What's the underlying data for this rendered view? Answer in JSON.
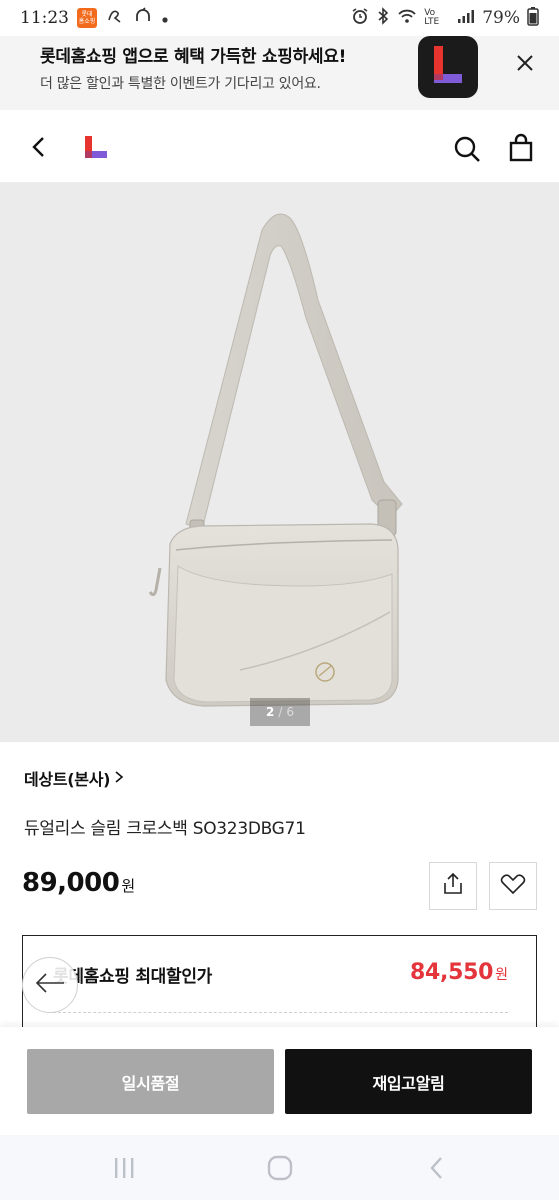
{
  "status_bar": {
    "time": "11:23",
    "app_icon_label": "롯데\n홈쇼핑",
    "network_label": "Vo LTE",
    "battery": "79%"
  },
  "app_banner": {
    "title": "롯데홈쇼핑 앱으로 혜택 가득한 쇼핑하세요!",
    "subtitle": "더 많은 할인과 특별한 이벤트가 기다리고 있어요."
  },
  "header": {
    "logo_icon": "lotte-l-logo-icon",
    "search_icon": "search-icon",
    "cart_icon": "shopping-bag-icon"
  },
  "image_gallery": {
    "current": "2",
    "separator": "/",
    "total": "6"
  },
  "product": {
    "brand": "데상트(본사)",
    "name": "듀얼리스 슬림 크로스백 SO323DBG71",
    "price": "89,000",
    "price_unit": "원"
  },
  "max_discount": {
    "label": "롯데홈쇼핑 최대할인가",
    "price": "84,550",
    "unit": "원"
  },
  "bottom_bar": {
    "soldout_label": "일시품절",
    "restock_label": "재입고알림"
  },
  "colors": {
    "accent_red": "#e3353b",
    "logo_red": "#e8342f",
    "logo_purple": "#7f5bd8",
    "soldout_gray": "#a8a8a8"
  }
}
